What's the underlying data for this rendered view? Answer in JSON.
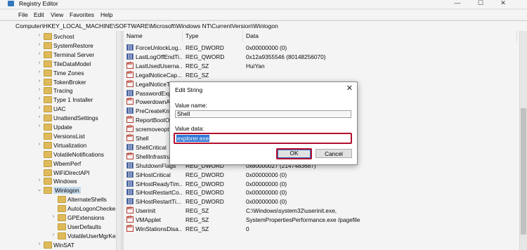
{
  "window": {
    "title": "Registry Editor",
    "minimize": "—",
    "maximize": "☐",
    "close": "✕"
  },
  "menu": [
    "File",
    "Edit",
    "View",
    "Favorites",
    "Help"
  ],
  "address": "Computer\\HKEY_LOCAL_MACHINE\\SOFTWARE\\Microsoft\\Windows NT\\CurrentVersion\\Winlogon",
  "tree": [
    {
      "label": "Svchost",
      "level": 1,
      "arrow": "›"
    },
    {
      "label": "SystemRestore",
      "level": 1,
      "arrow": "›"
    },
    {
      "label": "Terminal Server",
      "level": 1,
      "arrow": "›"
    },
    {
      "label": "TileDataModel",
      "level": 1,
      "arrow": "›"
    },
    {
      "label": "Time Zones",
      "level": 1,
      "arrow": "›"
    },
    {
      "label": "TokenBroker",
      "level": 1,
      "arrow": "›"
    },
    {
      "label": "Tracing",
      "level": 1,
      "arrow": "›"
    },
    {
      "label": "Type 1 Installer",
      "level": 1,
      "arrow": "›"
    },
    {
      "label": "UAC",
      "level": 1,
      "arrow": "›"
    },
    {
      "label": "UnattendSettings",
      "level": 1,
      "arrow": "›"
    },
    {
      "label": "Update",
      "level": 1,
      "arrow": "›"
    },
    {
      "label": "VersionsList",
      "level": 1,
      "arrow": ""
    },
    {
      "label": "Virtualization",
      "level": 1,
      "arrow": "›"
    },
    {
      "label": "VolatileNotifications",
      "level": 1,
      "arrow": ""
    },
    {
      "label": "WbemPerf",
      "level": 1,
      "arrow": ""
    },
    {
      "label": "WiFiDirectAPI",
      "level": 1,
      "arrow": ""
    },
    {
      "label": "Windows",
      "level": 1,
      "arrow": "›"
    },
    {
      "label": "Winlogon",
      "level": 1,
      "arrow": "⌄",
      "selected": true
    },
    {
      "label": "AlternateShells",
      "level": 2,
      "arrow": ""
    },
    {
      "label": "AutoLogonChecke",
      "level": 2,
      "arrow": ""
    },
    {
      "label": "GPExtensions",
      "level": 2,
      "arrow": "›"
    },
    {
      "label": "UserDefaults",
      "level": 2,
      "arrow": ""
    },
    {
      "label": "VolatileUserMgrKe",
      "level": 2,
      "arrow": "›"
    },
    {
      "label": "WinSAT",
      "level": 1,
      "arrow": "›"
    }
  ],
  "columns": [
    "Name",
    "Type",
    "Data"
  ],
  "rows": [
    {
      "name": "ForceUnlockLog...",
      "type": "REG_DWORD",
      "data": "0x00000000 (0)",
      "kind": "bin"
    },
    {
      "name": "LastLogOffEndTi...",
      "type": "REG_QWORD",
      "data": "0x12a9355546 (80148256070)",
      "kind": "bin"
    },
    {
      "name": "LastUsedUserna...",
      "type": "REG_SZ",
      "data": "HuiYan",
      "kind": "sz"
    },
    {
      "name": "LegalNoticeCap...",
      "type": "REG_SZ",
      "data": "",
      "kind": "sz"
    },
    {
      "name": "LegalNoticeT",
      "type": "",
      "data": "",
      "kind": "sz"
    },
    {
      "name": "PasswordExp",
      "type": "",
      "data": "",
      "kind": "bin"
    },
    {
      "name": "PowerdownA",
      "type": "",
      "data": "",
      "kind": "sz"
    },
    {
      "name": "PreCreateKn",
      "type": "",
      "data": "6)",
      "kind": "bin"
    },
    {
      "name": "ReportBootO",
      "type": "",
      "data": "",
      "kind": "sz"
    },
    {
      "name": "scremoveopt",
      "type": "",
      "data": "",
      "kind": "sz"
    },
    {
      "name": "Shell",
      "type": "",
      "data": "",
      "kind": "sz"
    },
    {
      "name": "ShellCritical",
      "type": "",
      "data": "",
      "kind": "bin"
    },
    {
      "name": "ShellInfrastru",
      "type": "",
      "data": "",
      "kind": "sz"
    },
    {
      "name": "ShutdownFlags",
      "type": "REG_DWORD",
      "data": "0x80000027 (2147483687)",
      "kind": "bin"
    },
    {
      "name": "SiHostCritical",
      "type": "REG_DWORD",
      "data": "0x00000000 (0)",
      "kind": "bin"
    },
    {
      "name": "SiHostReadyTim...",
      "type": "REG_DWORD",
      "data": "0x00000000 (0)",
      "kind": "bin"
    },
    {
      "name": "SiHostRestartCo...",
      "type": "REG_DWORD",
      "data": "0x00000000 (0)",
      "kind": "bin"
    },
    {
      "name": "SiHostRestartTi...",
      "type": "REG_DWORD",
      "data": "0x00000000 (0)",
      "kind": "bin"
    },
    {
      "name": "Userinit",
      "type": "REG_SZ",
      "data": "C:\\Windows\\system32\\userinit.exe,",
      "kind": "sz"
    },
    {
      "name": "VMApplet",
      "type": "REG_SZ",
      "data": "SystemPropertiesPerformance.exe /pagefile",
      "kind": "sz"
    },
    {
      "name": "WinStationsDisa...",
      "type": "REG_SZ",
      "data": "0",
      "kind": "sz"
    }
  ],
  "dialog": {
    "title": "Edit String",
    "close": "✕",
    "value_name_label": "Value name:",
    "value_name": "Shell",
    "value_data_label": "Value data:",
    "value_data": "explorer.exe",
    "ok": "OK",
    "cancel": "Cancel"
  },
  "colors": {
    "highlight_border": "#b3102f",
    "selection": "#2f78d6",
    "folder": "#e8c15a"
  }
}
